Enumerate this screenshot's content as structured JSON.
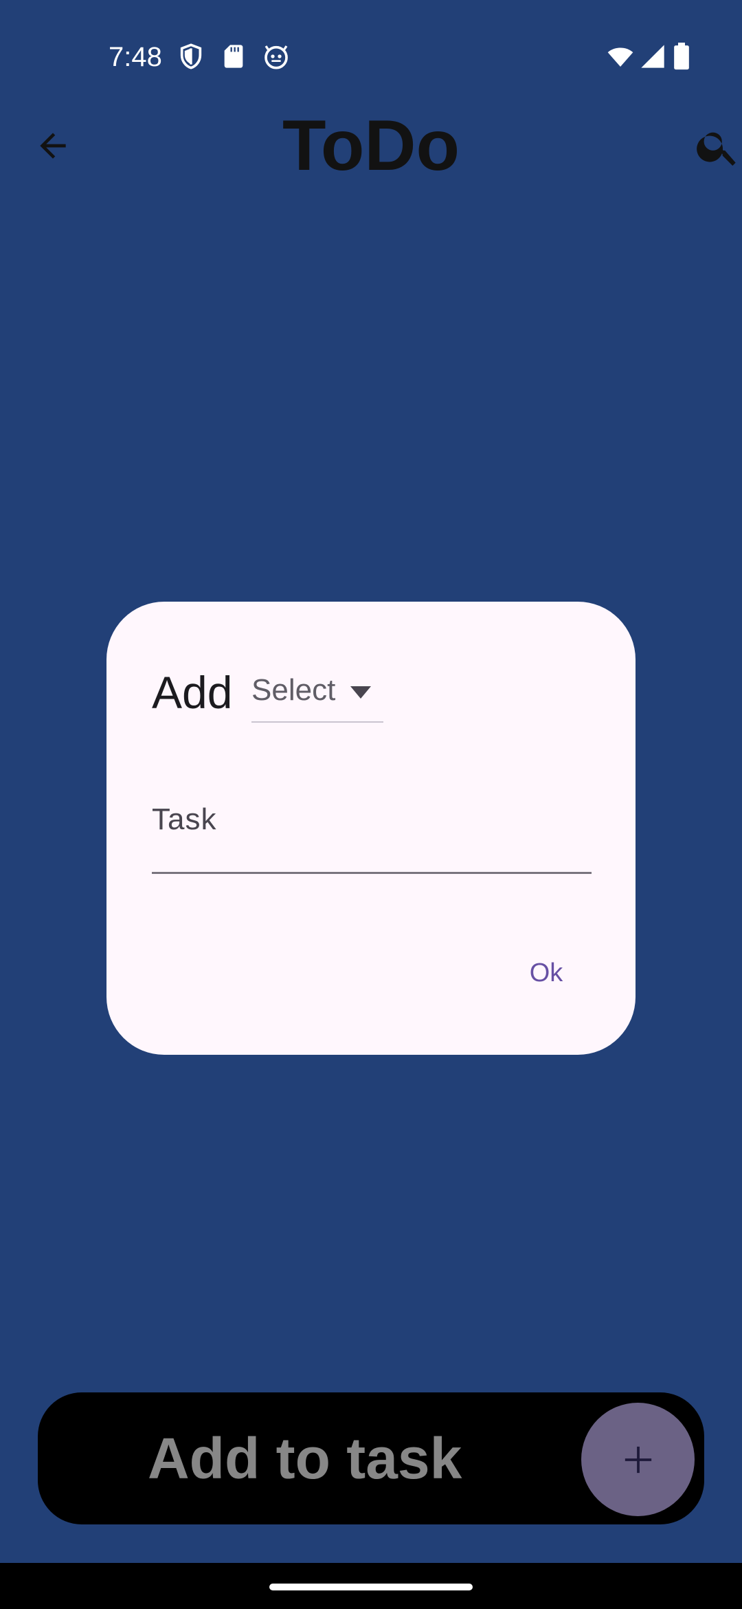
{
  "status_bar": {
    "time": "7:48",
    "left_icons": [
      "shield-icon",
      "sd-card-icon",
      "robot-face-icon"
    ],
    "right_icons": [
      "wifi-icon",
      "signal-icon",
      "battery-icon"
    ]
  },
  "app_bar": {
    "title": "ToDo",
    "back_icon": "arrow-back-icon",
    "search_icon": "search-icon"
  },
  "dialog": {
    "title": "Add",
    "select_label": "Select",
    "task_label": "Task",
    "task_value": "",
    "ok_label": "Ok"
  },
  "bottom_bar": {
    "label": "Add to task",
    "fab_icon": "plus-icon"
  },
  "colors": {
    "background": "#224077",
    "dialog_surface": "#fff7fd",
    "accent": "#6750a4",
    "fab": "#6b6285"
  }
}
